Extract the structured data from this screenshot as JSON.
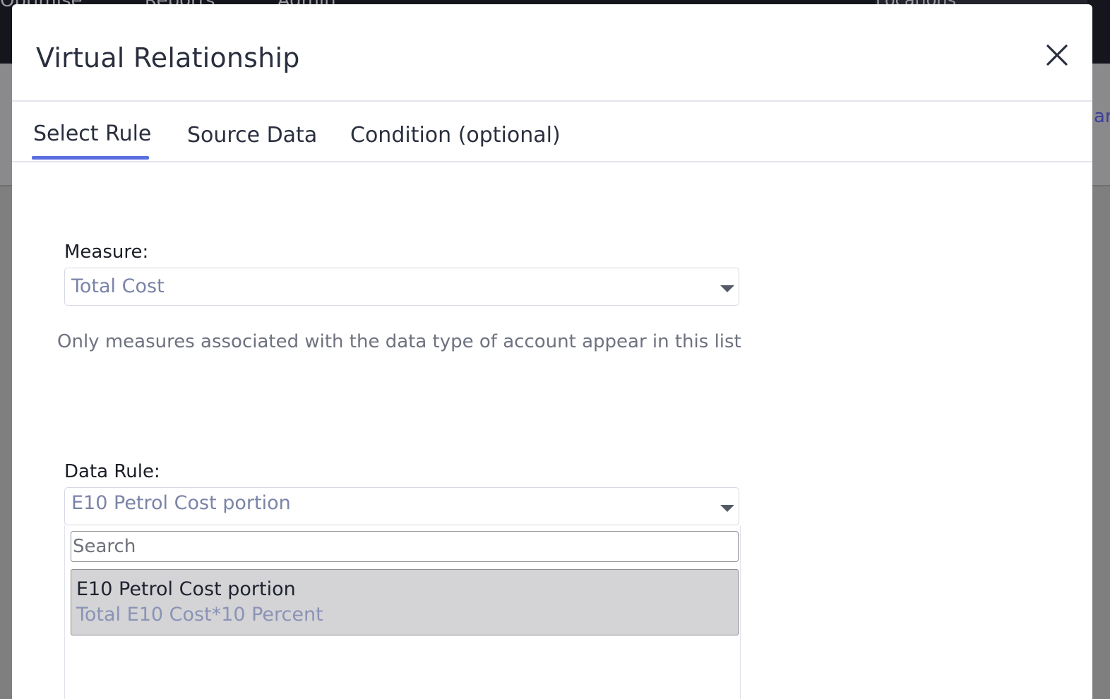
{
  "background": {
    "nav_items": [
      "Optimise",
      "Reports",
      "Admin"
    ],
    "locations_label": "Locations",
    "side_text": "ar"
  },
  "modal": {
    "title": "Virtual Relationship",
    "close_icon": "close-icon",
    "tabs": [
      {
        "label": "Select Rule",
        "active": true
      },
      {
        "label": "Source Data",
        "active": false
      },
      {
        "label": "Condition (optional)",
        "active": false
      }
    ],
    "accent_color": "#5b6ee1"
  },
  "form": {
    "measure": {
      "label": "Measure:",
      "value": "Total Cost",
      "help": "Only measures associated with the data type of account appear in this list"
    },
    "data_rule": {
      "label": "Data Rule:",
      "value": "E10 Petrol Cost portion",
      "search_placeholder": "Search",
      "search_value": "",
      "options": [
        {
          "title": "E10 Petrol Cost portion",
          "subtitle": "Total E10 Cost*10 Percent",
          "highlighted": true
        }
      ]
    }
  }
}
